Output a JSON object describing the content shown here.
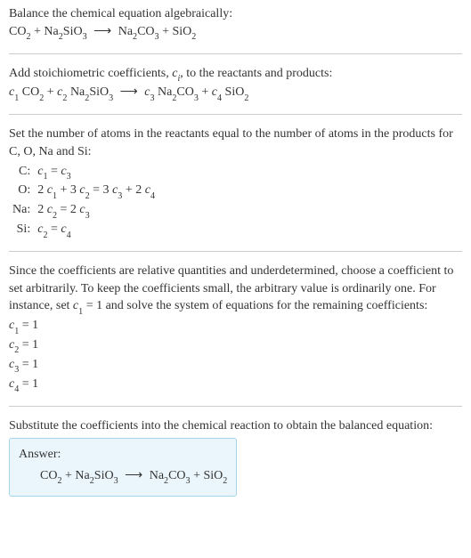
{
  "sec1": {
    "line1a": "Balance the chemical equation algebraically:",
    "eq_co2": "CO",
    "eq_co2_sub": "2",
    "eq_plus": " + ",
    "eq_na2sio3_na": "Na",
    "eq_na2sio3_2": "2",
    "eq_na2sio3_sio": "SiO",
    "eq_na2sio3_3": "3",
    "eq_arrow": "⟶",
    "eq_na2co3_na": "Na",
    "eq_na2co3_2": "2",
    "eq_na2co3_co": "CO",
    "eq_na2co3_3": "3",
    "eq_sio2_si": "SiO",
    "eq_sio2_2": "2"
  },
  "sec2": {
    "line1a": "Add stoichiometric coefficients, ",
    "ci_c": "c",
    "ci_i": "i",
    "line1b": ", to the reactants and products:",
    "c1_c": "c",
    "c1_n": "1",
    "c2_c": "c",
    "c2_n": "2",
    "c3_c": "c",
    "c3_n": "3",
    "c4_c": "c",
    "c4_n": "4"
  },
  "sec3": {
    "intro": "Set the number of atoms in the reactants equal to the number of atoms in the products for C, O, Na and Si:",
    "rows": {
      "C_label": "C:",
      "C_eq_l": "c",
      "C_eq_l_n": "1",
      "C_eq_mid": " = ",
      "C_eq_r": "c",
      "C_eq_r_n": "3",
      "O_label": "O:",
      "O_eq_a": "2 ",
      "O_eq_c1": "c",
      "O_eq_c1n": "1",
      "O_eq_b": " + 3 ",
      "O_eq_c2": "c",
      "O_eq_c2n": "2",
      "O_eq_c": " = 3 ",
      "O_eq_c3": "c",
      "O_eq_c3n": "3",
      "O_eq_d": " + 2 ",
      "O_eq_c4": "c",
      "O_eq_c4n": "4",
      "Na_label": "Na:",
      "Na_eq_a": "2 ",
      "Na_eq_c2": "c",
      "Na_eq_c2n": "2",
      "Na_eq_b": " = 2 ",
      "Na_eq_c3": "c",
      "Na_eq_c3n": "3",
      "Si_label": "Si:",
      "Si_eq_c2": "c",
      "Si_eq_c2n": "2",
      "Si_eq_mid": " = ",
      "Si_eq_c4": "c",
      "Si_eq_c4n": "4"
    }
  },
  "sec4": {
    "para_a": "Since the coefficients are relative quantities and underdetermined, choose a coefficient to set arbitrarily. To keep the coefficients small, the arbitrary value is ordinarily one. For instance, set ",
    "para_c": "c",
    "para_cn": "1",
    "para_b": " = 1 and solve the system of equations for the remaining coefficients:",
    "r1_c": "c",
    "r1_n": "1",
    "r1_v": " = 1",
    "r2_c": "c",
    "r2_n": "2",
    "r2_v": " = 1",
    "r3_c": "c",
    "r3_n": "3",
    "r3_v": " = 1",
    "r4_c": "c",
    "r4_n": "4",
    "r4_v": " = 1"
  },
  "sec5": {
    "intro": "Substitute the coefficients into the chemical reaction to obtain the balanced equation:",
    "answer_label": "Answer:"
  }
}
